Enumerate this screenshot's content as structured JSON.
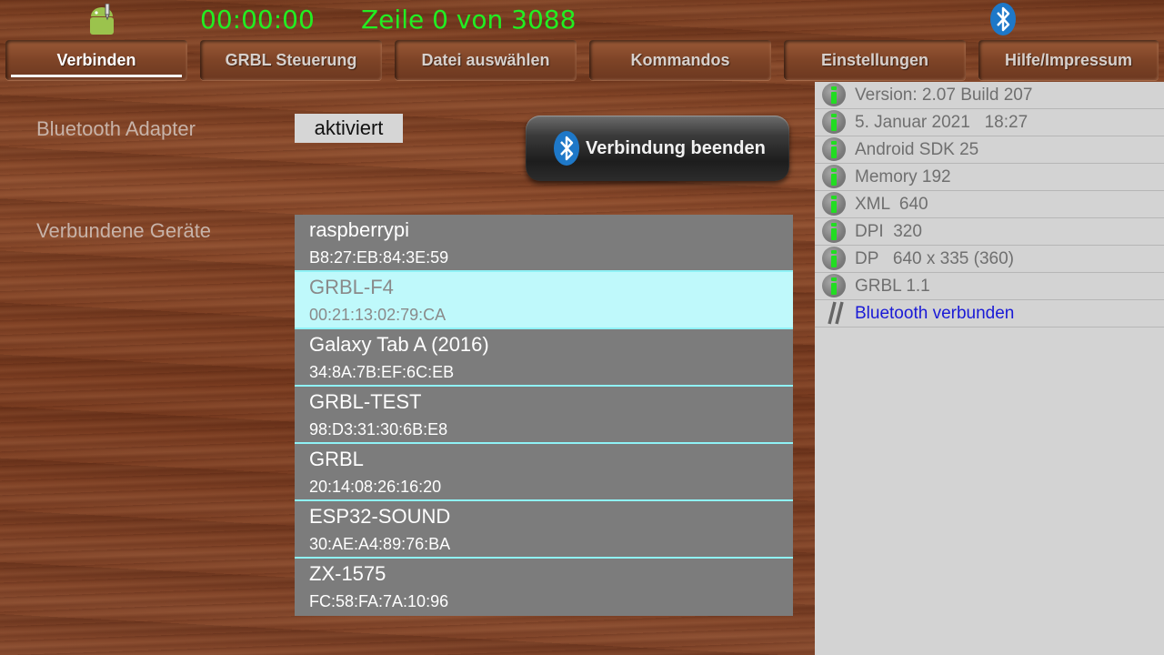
{
  "header": {
    "timer": "00:00:00",
    "line_status": "Zeile 0 von 3088"
  },
  "tabs": [
    {
      "label": "Verbinden",
      "active": true
    },
    {
      "label": "GRBL Steuerung",
      "active": false
    },
    {
      "label": "Datei auswählen",
      "active": false
    },
    {
      "label": "Kommandos",
      "active": false
    },
    {
      "label": "Einstellungen",
      "active": false
    },
    {
      "label": "Hilfe/Impressum",
      "active": false
    }
  ],
  "connection": {
    "adapter_label": "Bluetooth Adapter",
    "adapter_state": "aktiviert",
    "disconnect_label": "Verbindung beenden",
    "devices_label": "Verbundene Geräte"
  },
  "devices": [
    {
      "name": "raspberrypi",
      "mac": "B8:27:EB:84:3E:59",
      "selected": false
    },
    {
      "name": "GRBL-F4",
      "mac": "00:21:13:02:79:CA",
      "selected": true
    },
    {
      "name": "Galaxy Tab A (2016)",
      "mac": "34:8A:7B:EF:6C:EB",
      "selected": false
    },
    {
      "name": "GRBL-TEST",
      "mac": "98:D3:31:30:6B:E8",
      "selected": false
    },
    {
      "name": "GRBL",
      "mac": "20:14:08:26:16:20",
      "selected": false
    },
    {
      "name": "ESP32-SOUND",
      "mac": "30:AE:A4:89:76:BA",
      "selected": false
    },
    {
      "name": "ZX-1575",
      "mac": "FC:58:FA:7A:10:96",
      "selected": false
    }
  ],
  "info": [
    {
      "text": "Version: 2.07 Build 207",
      "icon": "info-icon"
    },
    {
      "text": "5. Januar 2021   18:27",
      "icon": "info-icon"
    },
    {
      "text": "Android SDK 25",
      "icon": "info-icon"
    },
    {
      "text": "Memory 192",
      "icon": "info-icon"
    },
    {
      "text": "XML  640",
      "icon": "info-icon"
    },
    {
      "text": "DPI  320",
      "icon": "info-icon"
    },
    {
      "text": "DP   640 x 335 (360)",
      "icon": "info-icon"
    },
    {
      "text": "GRBL 1.1",
      "icon": "info-icon"
    },
    {
      "text": "Bluetooth verbunden",
      "icon": "slash-icon"
    }
  ],
  "colors": {
    "timer_green": "#22ee22",
    "selected_device": "#bff9fb",
    "bluetooth_link": "#1a1ad6"
  }
}
